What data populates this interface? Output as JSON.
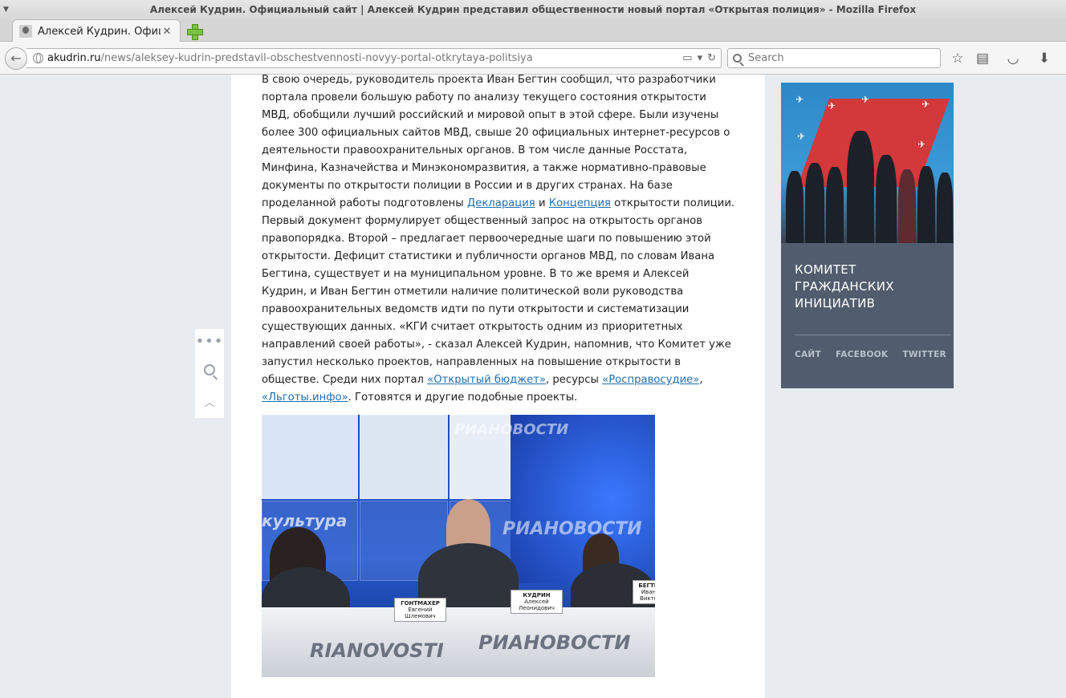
{
  "window": {
    "title": "Алексей Кудрин. Официальный сайт | Алексей Кудрин представил общественности новый портал «Открытая полиция» - Mozilla Firefox"
  },
  "tab": {
    "title": "Алексей Кудрин. Официа",
    "close": "✕"
  },
  "urlbar": {
    "domain": "akudrin.ru",
    "path": "/news/aleksey-kudrin-predstavil-obschestvennosti-novyy-portal-otkrytaya-politsiya"
  },
  "search": {
    "placeholder": "Search"
  },
  "article": {
    "p1": "В свою очередь, руководитель проекта Иван Бегтин сообщил, что разработчики портала провели большую работу по анализу текущего состояния открытости МВД, обобщили лучший российский и мировой опыт в этой сфере. Были изучены более 300 официальных сайтов МВД, свыше 20 официальных интернет-ресурсов о деятельности правоохранительных органов. В том числе данные Росстата, Минфина, Казначейства и Минэкономразвития, а также нормативно-правовые документы по открытости полиции в России и в других странах. На базе проделанной работы подготовлены ",
    "link_declaration": "Декларация",
    "and1": " и ",
    "link_concept": "Концепция",
    "p2": " открытости полиции. Первый документ формулирует общественный запрос на открытость органов правопорядка. Второй – предлагает первоочередные шаги по повышению этой открытости. Дефицит статистики и публичности органов МВД, по словам Ивана Бегтина, существует и на муниципальном уровне. В то же время и Алексей Кудрин, и Иван Бегтин отметили наличие политической воли руководства правоохранительных ведомств идти по пути открытости и систематизации существующих данных. «КГИ считает открытость одним из приоритетных направлений своей работы», - сказал Алексей Кудрин, напомнив, что Комитет уже запустил несколько проектов, направленных на повышение открытости в обществе. Среди них портал ",
    "link_budget": "«Открытый бюджет»",
    "sep1": ", ресурсы ",
    "link_justice": "«Росправосудие»",
    "sep2": ", ",
    "link_benefits": "«Льготы.инфо»",
    "p3": ". Готовятся и другие подобные проекты."
  },
  "photo": {
    "brand_desk": "RIANOVOSTI",
    "brand_desk_ru": "РИАНОВОСТИ",
    "brand_screen": "РИАНОВОСТИ",
    "screen_text": "культура",
    "plate1_name": "ГОНТМАХЕР",
    "plate1_sub": "Евгений Шлемович",
    "plate2_name": "КУДРИН",
    "plate2_sub": "Алексей Леонидович",
    "plate3_name": "БЕГТИ",
    "plate3_sub": "Иван Викто"
  },
  "sidebar": {
    "title": "КОМИТЕТ ГРАЖДАНСКИХ ИНИЦИАТИВ",
    "links": [
      "САЙТ",
      "FACEBOOK",
      "TWITTER"
    ]
  },
  "colors": {
    "link": "#1f6fb0",
    "sidebar_bg": "#515d6e",
    "page_bg": "#e8ebf0"
  }
}
